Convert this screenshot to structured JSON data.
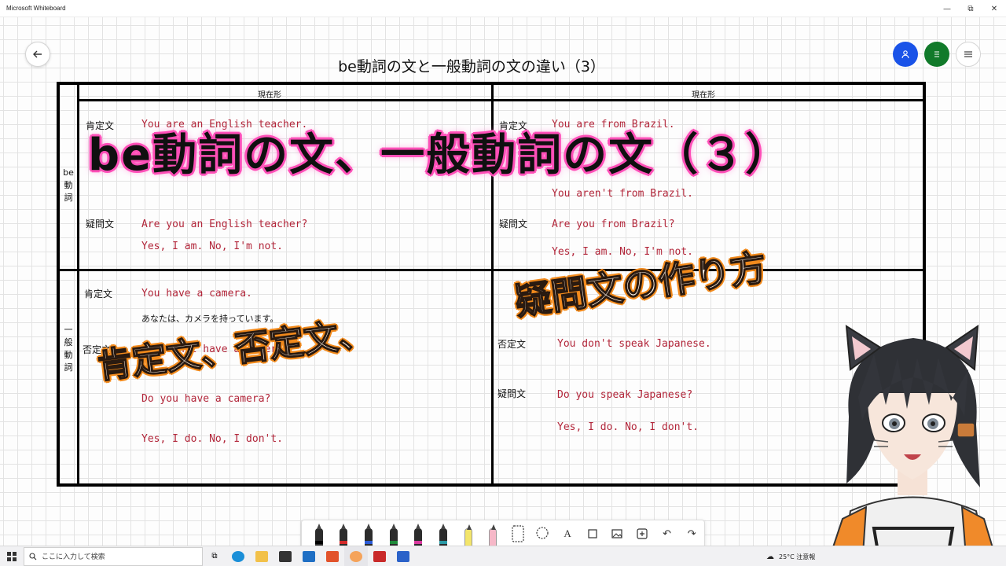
{
  "window": {
    "title": "Microsoft Whiteboard",
    "minimize": "—",
    "restore": "⧉",
    "close": "✕"
  },
  "board": {
    "title": "be動詞の文と一般動詞の文の違い（3）",
    "header_present_left": "現在形",
    "header_present_right": "現在形",
    "row_be": "be動詞",
    "row_general": "一般動詞",
    "labels": {
      "affirmative": "肯定文",
      "negative": "否定文",
      "question": "疑問文"
    },
    "be_left": {
      "aff": "You are an English teacher.",
      "q": "Are you an English teacher?",
      "ans": "Yes, I am.    No, I'm not."
    },
    "be_right": {
      "aff": "You are from Brazil.",
      "neg": "You aren't from Brazil.",
      "q": "Are you from Brazil?",
      "ans": "Yes, I am.   No, I'm not."
    },
    "gen_left": {
      "aff": "You have a camera.",
      "jp": "あなたは、カメラを持っています。",
      "neg": "You don't have a camera.",
      "q": "Do you have a camera?",
      "ans": "Yes, I do.   No, I don't."
    },
    "gen_right": {
      "neg": "You don't speak Japanese.",
      "q": "Do you speak Japanese?",
      "ans": "Yes, I do.   No, I don't."
    }
  },
  "overlay": {
    "headline": "be動詞の文、一般動詞の文（３）",
    "line_left": "肯定文、否定文、",
    "line_right": "疑問文の作り方"
  },
  "taskbar": {
    "search_placeholder": "ここに入力して検索",
    "weather": "25°C  注意報"
  },
  "colors": {
    "red_text": "#b2263a",
    "pink_glow": "#ff4fb8",
    "orange_glow": "#f28a1c",
    "user_button": "#1a53e8",
    "green_button": "#117a2a"
  },
  "icons": {
    "back": "arrow-left-icon",
    "user": "person-icon",
    "menu": "hamburger-icon"
  }
}
